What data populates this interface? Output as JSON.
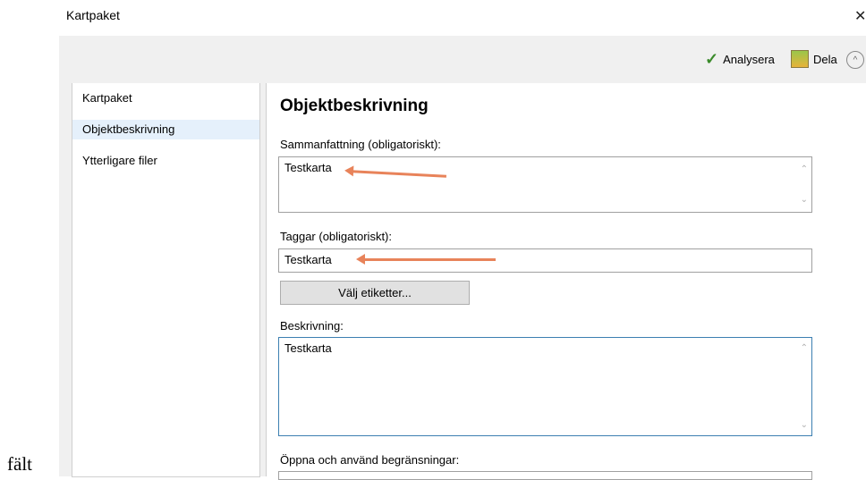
{
  "window": {
    "title": "Kartpaket",
    "close_glyph": "✕"
  },
  "toolbar": {
    "analyze_label": "Analysera",
    "share_label": "Dela",
    "collapse_glyph": "^"
  },
  "nav": {
    "items": [
      {
        "label": "Kartpaket",
        "selected": false
      },
      {
        "label": "Objektbeskrivning",
        "selected": true
      },
      {
        "label": "Ytterligare filer",
        "selected": false
      }
    ]
  },
  "form": {
    "heading": "Objektbeskrivning",
    "summary_label": "Sammanfattning (obligatoriskt):",
    "summary_value": "Testkarta",
    "tags_label": "Taggar (obligatoriskt):",
    "tags_value": "Testkarta",
    "choose_tags_button": "Välj etiketter...",
    "description_label": "Beskrivning:",
    "description_value": "Testkarta",
    "access_label": "Öppna och använd begränsningar:"
  },
  "annotation": {
    "side_text": "fält",
    "arrow_color": "#e8835a"
  },
  "icons": {
    "analyze": "checkmark-icon",
    "share": "share-package-icon",
    "collapse": "chevron-up-circle-icon"
  }
}
